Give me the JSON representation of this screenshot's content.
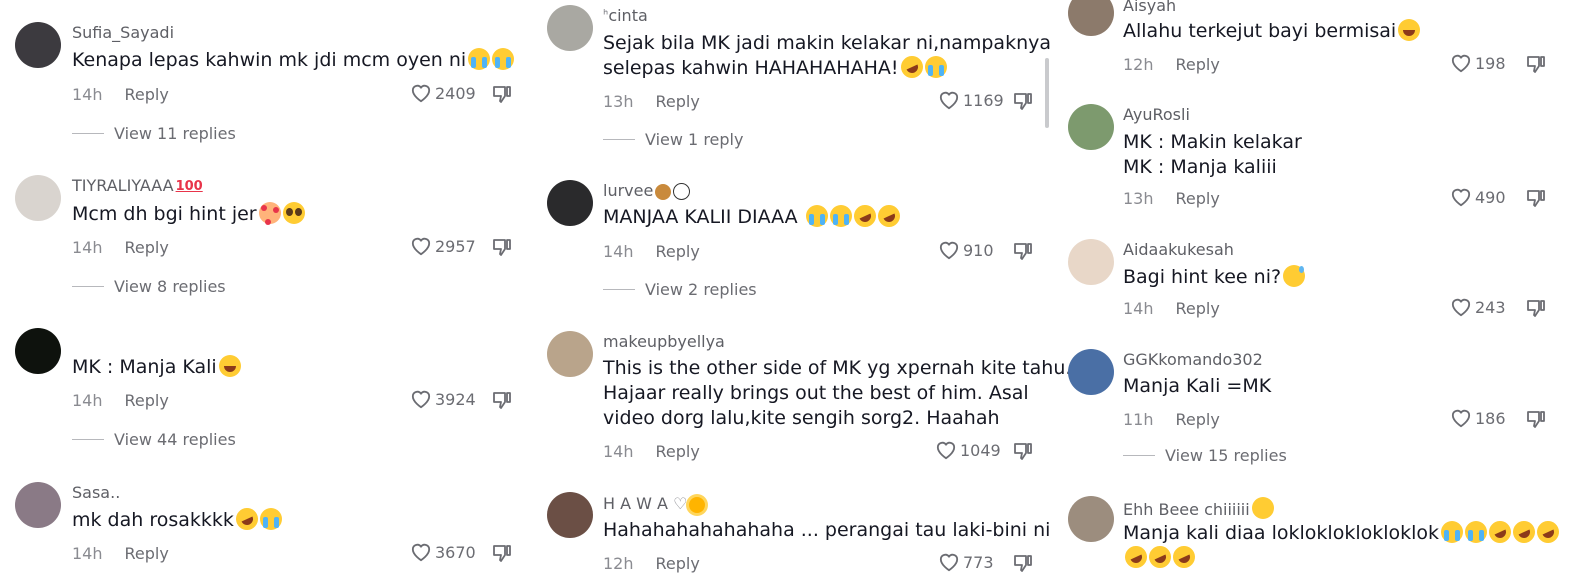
{
  "columns": [
    {
      "comments": [
        {
          "username": "Sufia_Sayadi",
          "text": "Kenapa lepas kahwin mk jdi mcm oyen ni",
          "emojis": [
            "cry",
            "cry"
          ],
          "time": "14h",
          "reply": "Reply",
          "likes": "2409",
          "view_replies": "View 11 replies",
          "avatar_color": "#3c3a3f"
        },
        {
          "username": "TIYRALIYAAA",
          "username_emoji": "hundred",
          "text": "Mcm dh bgi hint jer",
          "emojis": [
            "hearts",
            "plead"
          ],
          "time": "14h",
          "reply": "Reply",
          "likes": "2957",
          "view_replies": "View 8 replies",
          "avatar_color": "#d9d4cf"
        },
        {
          "username": "",
          "text": "MK : Manja Kali",
          "emojis": [
            "laugh"
          ],
          "time": "14h",
          "reply": "Reply",
          "likes": "3924",
          "view_replies": "View 44 replies",
          "avatar_color": "#0e120d"
        },
        {
          "username": "Sasa..",
          "text": "mk dah rosakkkk",
          "emojis": [
            "rofl",
            "cry"
          ],
          "time": "14h",
          "reply": "Reply",
          "likes": "3670",
          "view_replies": "",
          "avatar_color": "#8a7a86"
        }
      ]
    },
    {
      "comments": [
        {
          "username": "cinta",
          "text": "Sejak bila MK jadi makin kelakar ni,nampaknya",
          "text2": "selepas kahwin HAHAHAHAHA!",
          "emojis": [
            "rofl",
            "cry"
          ],
          "time": "13h",
          "reply": "Reply",
          "likes": "1169",
          "view_replies": "View 1 reply",
          "avatar_color": "#a9a8a2"
        },
        {
          "username": "lurvee",
          "username_emoji": "snailball",
          "text": "MANJAA KALII DIAAA",
          "emojis": [
            "cry",
            "cry",
            "rofl",
            "rofl"
          ],
          "time": "14h",
          "reply": "Reply",
          "likes": "910",
          "view_replies": "View 2 replies",
          "avatar_color": "#2a2a2c"
        },
        {
          "username": "makeupbyellya",
          "text": "This is the other side of MK yg xpernah kite tahu.",
          "text2": "Hajaar really brings out the best of him. Asal",
          "text3": "video dorg lalu,kite sengih sorg2. Haahah",
          "emojis": [],
          "time": "14h",
          "reply": "Reply",
          "likes": "1049",
          "view_replies": "",
          "avatar_color": "#b9a48b"
        },
        {
          "username": "H A W A",
          "username_emoji": "sun",
          "text": "Hahahahahahahaha ... perangai tau laki-bini ni",
          "emojis": [],
          "time": "12h",
          "reply": "Reply",
          "likes": "773",
          "view_replies": "",
          "avatar_color": "#6b4f45"
        }
      ]
    },
    {
      "comments": [
        {
          "username": "Aisyah",
          "text": "Allahu terkejut bayi bermisai",
          "emojis": [
            "laugh"
          ],
          "time": "12h",
          "reply": "Reply",
          "likes": "198",
          "view_replies": "",
          "avatar_color": "#8c7a6b"
        },
        {
          "username": "AyuRosli",
          "text": "MK : Makin kelakar",
          "text2": "MK : Manja kaliii",
          "emojis": [],
          "time": "13h",
          "reply": "Reply",
          "likes": "490",
          "view_replies": "",
          "avatar_color": "#7d9a6e"
        },
        {
          "username": "Aidaakukesah",
          "text": "Bagi hint kee ni?",
          "emojis": [
            "sweat"
          ],
          "time": "14h",
          "reply": "Reply",
          "likes": "243",
          "view_replies": "",
          "avatar_color": "#e8d7c8"
        },
        {
          "username": "GGKkomando302",
          "text": "Manja Kali =MK",
          "emojis": [],
          "time": "11h",
          "reply": "Reply",
          "likes": "186",
          "view_replies": "View 15 replies",
          "avatar_color": "#4a6fa5"
        },
        {
          "username": "Ehh Beee chiiiiii",
          "username_emoji": "smirk",
          "text": "Manja kali diaa loklokloklokloklok",
          "emojis": [
            "cry",
            "cry",
            "rofl",
            "rofl",
            "rofl"
          ],
          "emojis2": [
            "rofl",
            "rofl",
            "rofl"
          ],
          "time": "",
          "reply": "",
          "likes": "",
          "view_replies": "",
          "avatar_color": "#9c8d7e"
        }
      ]
    }
  ]
}
